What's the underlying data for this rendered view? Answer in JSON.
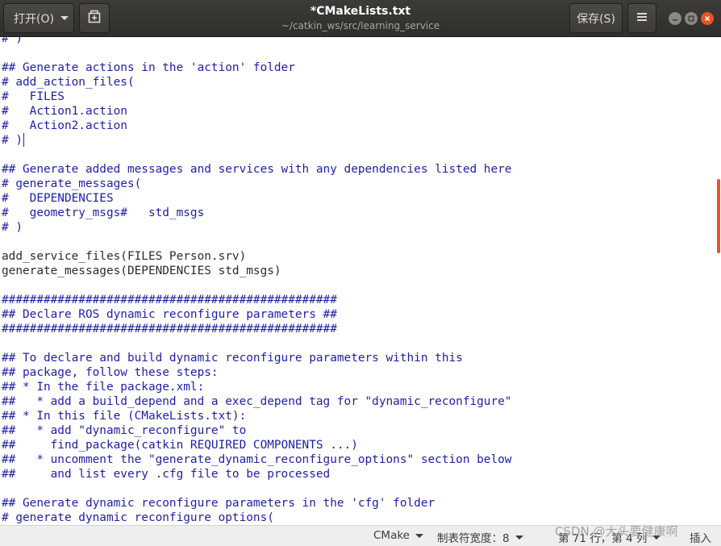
{
  "header": {
    "open_label": "打开(O)",
    "save_label": "保存(S)",
    "title": "*CMakeLists.txt",
    "subtitle": "~/catkin_ws/src/learning_service"
  },
  "editor": {
    "lines": [
      "# )",
      "",
      "## Generate actions in the 'action' folder",
      "# add_action_files(",
      "#   FILES",
      "#   Action1.action",
      "#   Action2.action",
      "# )",
      "",
      "## Generate added messages and services with any dependencies listed here",
      "# generate_messages(",
      "#   DEPENDENCIES",
      "#   geometry_msgs#   std_msgs",
      "# )",
      "",
      "add_service_files(FILES Person.srv)",
      "generate_messages(DEPENDENCIES std_msgs)",
      "",
      "################################################",
      "## Declare ROS dynamic reconfigure parameters ##",
      "################################################",
      "",
      "## To declare and build dynamic reconfigure parameters within this",
      "## package, follow these steps:",
      "## * In the file package.xml:",
      "##   * add a build_depend and a exec_depend tag for \"dynamic_reconfigure\"",
      "## * In this file (CMakeLists.txt):",
      "##   * add \"dynamic_reconfigure\" to",
      "##     find_package(catkin REQUIRED COMPONENTS ...)",
      "##   * uncomment the \"generate_dynamic_reconfigure_options\" section below",
      "##     and list every .cfg file to be processed",
      "",
      "## Generate dynamic reconfigure parameters in the 'cfg' folder",
      "# generate dynamic reconfigure options("
    ]
  },
  "statusbar": {
    "language": "CMake",
    "tab_width": "制表符宽度：8",
    "position": "第 71 行，第 4 列",
    "mode": "插入"
  },
  "watermark": "CSDN @大头要健康啊",
  "colors": {
    "comment": "#1e1ea8",
    "code": "#2b2b2b",
    "accent": "#e95420",
    "header_bg": "#3c3b37"
  },
  "icons": [
    "new-document-icon",
    "hamburger-menu-icon",
    "minimize-icon",
    "maximize-icon",
    "close-icon",
    "chevron-down-icon"
  ]
}
